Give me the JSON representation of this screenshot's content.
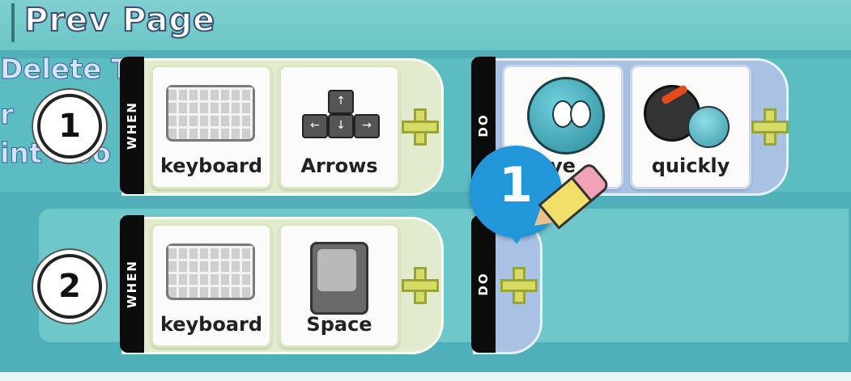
{
  "header": {
    "prev_page": "Prev Page"
  },
  "side_menu": {
    "item1": "Delete T",
    "item2": "r",
    "item3": "int Roo"
  },
  "rules": [
    {
      "number": "1",
      "when_label": "WHEN",
      "do_label": "DO",
      "when_tiles": [
        "keyboard",
        "Arrows"
      ],
      "do_tiles": [
        "ve",
        "quickly"
      ]
    },
    {
      "number": "2",
      "when_label": "WHEN",
      "do_label": "DO",
      "when_tiles": [
        "keyboard",
        "Space"
      ],
      "do_tiles": []
    }
  ],
  "callout": {
    "number": "1"
  },
  "icons": [
    "keyboard-icon",
    "arrow-keys-icon",
    "spacebar-icon",
    "move-face-icon",
    "speedometer-icon",
    "plus-icon",
    "pencil-icon"
  ],
  "colors": {
    "board": "#4fb0b9",
    "marker": "#2196d9",
    "plus": "#d6dc63"
  }
}
